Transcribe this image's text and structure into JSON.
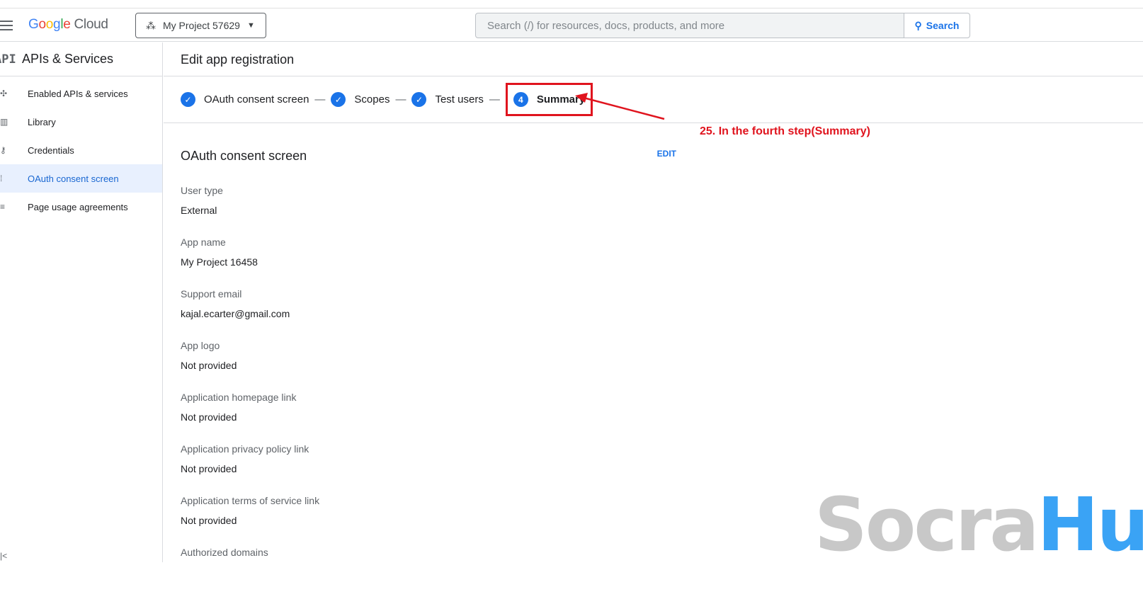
{
  "header": {
    "logo": "Google Cloud",
    "project": "My Project 57629",
    "search_placeholder": "Search (/) for resources, docs, products, and more",
    "search_button": "Search"
  },
  "sidebar": {
    "title": "APIs & Services",
    "items": [
      {
        "label": "Enabled APIs & services",
        "icon": "✣"
      },
      {
        "label": "Library",
        "icon": "▥"
      },
      {
        "label": "Credentials",
        "icon": "⚷"
      },
      {
        "label": "OAuth consent screen",
        "icon": "⁞"
      },
      {
        "label": "Page usage agreements",
        "icon": "≡"
      }
    ]
  },
  "main": {
    "title": "Edit app registration",
    "steps": [
      "OAuth consent screen",
      "Scopes",
      "Test users",
      "Summary"
    ],
    "current_step_number": "4",
    "section_title": "OAuth consent screen",
    "edit_label": "EDIT",
    "fields": [
      {
        "label": "User type",
        "value": "External"
      },
      {
        "label": "App name",
        "value": "My Project 16458"
      },
      {
        "label": "Support email",
        "value": "kajal.ecarter@gmail.com"
      },
      {
        "label": "App logo",
        "value": "Not provided"
      },
      {
        "label": "Application homepage link",
        "value": "Not provided"
      },
      {
        "label": "Application privacy policy link",
        "value": "Not provided"
      },
      {
        "label": "Application terms of service link",
        "value": "Not provided"
      },
      {
        "label": "Authorized domains",
        "value": ""
      }
    ]
  },
  "annotation": "25. In the fourth step(Summary)",
  "watermark": {
    "part1": "Socra",
    "part2": "Hub"
  }
}
